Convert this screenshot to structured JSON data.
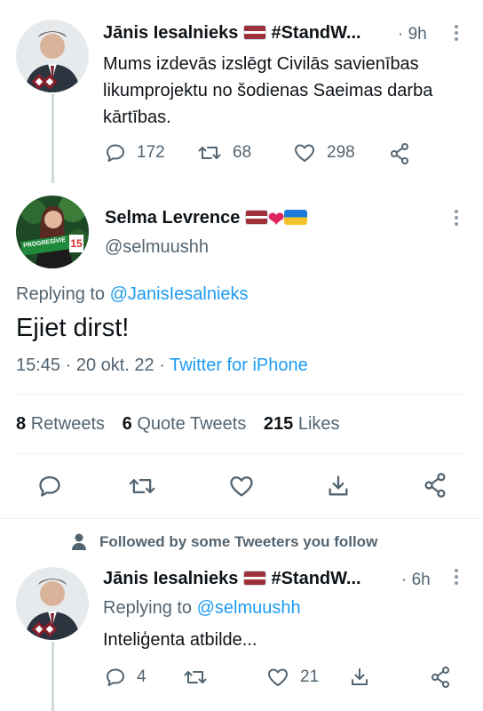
{
  "tweet1": {
    "author_name": "Jānis Iesalnieks",
    "author_tag": "#StandW...",
    "time": "· 9h",
    "text": "Mums izdevās izslēgt Civilās savienības likumprojektu no šodienas Saeimas darba kārtības.",
    "reply_count": "172",
    "retweet_count": "68",
    "like_count": "298"
  },
  "main_tweet": {
    "author_name": "Selma Levrence",
    "handle": "@selmuushh",
    "avatar_sign_text": "PROGRESĪVIE",
    "avatar_number": "15",
    "replying_prefix": "Replying to",
    "replying_handle": "@JanisIesalnieks",
    "text": "Ejiet dirst!",
    "timestamp": "15:45 · 20 okt. 22 ·",
    "source": "Twitter for iPhone",
    "retweets_count": "8",
    "retweets_label": "Retweets",
    "quotes_count": "6",
    "quotes_label": "Quote Tweets",
    "likes_count": "215",
    "likes_label": "Likes"
  },
  "social_context": {
    "text": "Followed by some Tweeters you follow"
  },
  "tweet3": {
    "author_name": "Jānis Iesalnieks",
    "author_tag": "#StandW...",
    "time": "· 6h",
    "replying_prefix": "Replying to",
    "replying_handle": "@selmuushh",
    "text": "Inteliģenta atbilde...",
    "reply_count": "4",
    "like_count": "21"
  },
  "colors": {
    "text": "#0f1419",
    "muted": "#536471",
    "link": "#1d9bf0",
    "divider": "#eff3f4",
    "thread_line": "#cfd9de"
  }
}
